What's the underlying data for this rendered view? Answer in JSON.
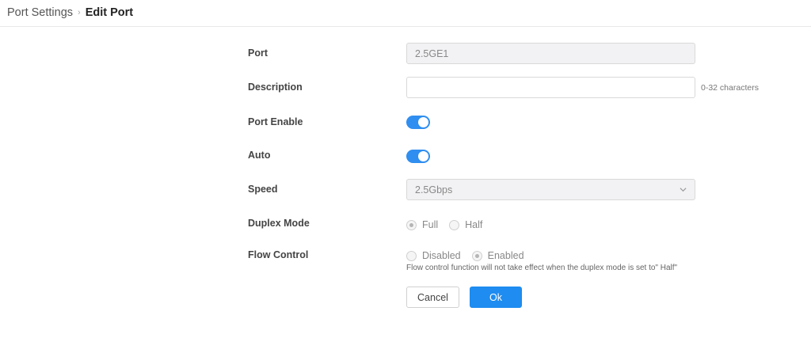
{
  "breadcrumb": {
    "parent": "Port Settings",
    "current": "Edit Port"
  },
  "form": {
    "port": {
      "label": "Port",
      "value": "2.5GE1"
    },
    "description": {
      "label": "Description",
      "value": "",
      "placeholder": "",
      "hint": "0-32 characters"
    },
    "port_enable": {
      "label": "Port Enable",
      "on": true
    },
    "auto": {
      "label": "Auto",
      "on": true
    },
    "speed": {
      "label": "Speed",
      "value": "2.5Gbps"
    },
    "duplex": {
      "label": "Duplex Mode",
      "options": [
        "Full",
        "Half"
      ],
      "selected": "Full"
    },
    "flow_control": {
      "label": "Flow Control",
      "options": [
        "Disabled",
        "Enabled"
      ],
      "selected": "Enabled",
      "note": "Flow control function will not take effect when the duplex mode is set to\" Half\""
    }
  },
  "buttons": {
    "cancel": "Cancel",
    "ok": "Ok"
  },
  "colors": {
    "accent": "#1e8cf0",
    "toggle_on": "#2f8ef0"
  },
  "icons": {
    "breadcrumb_separator": "chevron-right-icon",
    "speed_select": "chevron-down-icon"
  }
}
